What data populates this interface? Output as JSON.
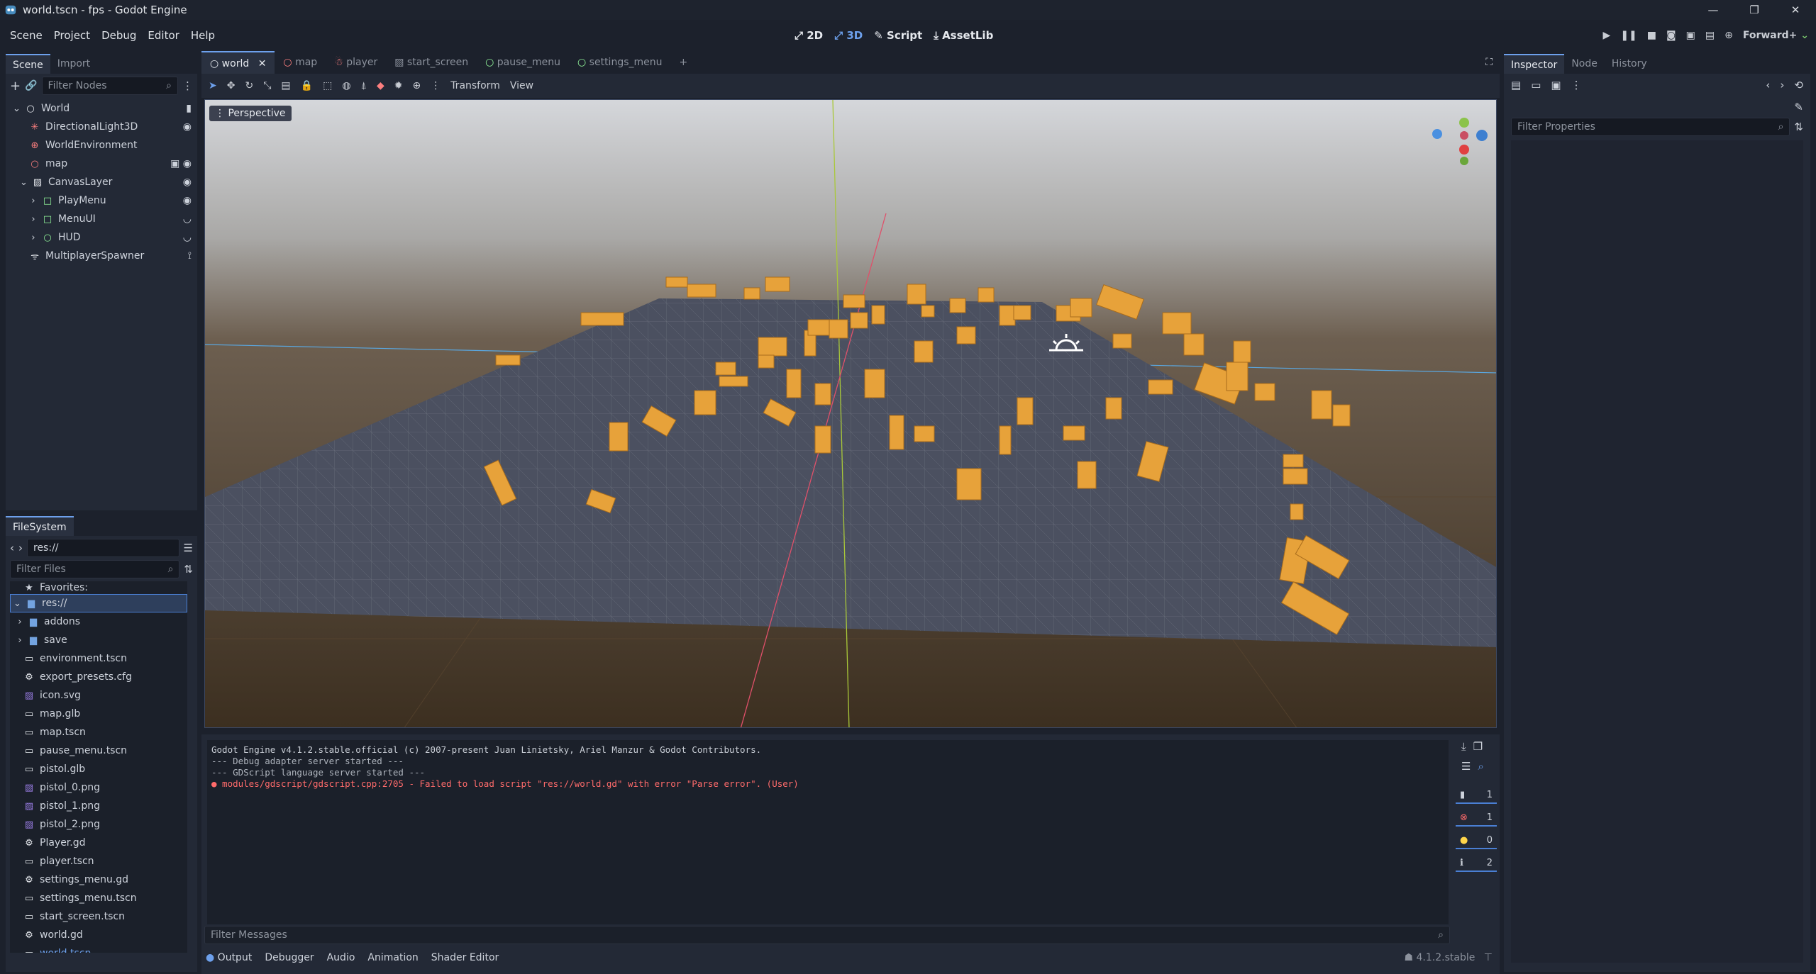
{
  "window": {
    "title": "world.tscn - fps - Godot Engine",
    "controls": [
      "—",
      "❐",
      "✕"
    ]
  },
  "menu": [
    "Scene",
    "Project",
    "Debug",
    "Editor",
    "Help"
  ],
  "modes": {
    "m2d": "2D",
    "m3d": "3D",
    "script": "Script",
    "assetlib": "AssetLib"
  },
  "renderer": "Forward+",
  "scene_panel": {
    "tabs": [
      "Scene",
      "Import"
    ],
    "filter_placeholder": "Filter Nodes",
    "tree": [
      {
        "label": "World",
        "icon": "node3d-icon",
        "depth": 0
      },
      {
        "label": "DirectionalLight3D",
        "icon": "light-icon",
        "depth": 1
      },
      {
        "label": "WorldEnvironment",
        "icon": "globe-icon",
        "depth": 1
      },
      {
        "label": "map",
        "icon": "node3d-icon",
        "depth": 1
      },
      {
        "label": "CanvasLayer",
        "icon": "canvas-icon",
        "depth": 1
      },
      {
        "label": "PlayMenu",
        "icon": "control-icon",
        "depth": 2
      },
      {
        "label": "MenuUI",
        "icon": "control-icon",
        "depth": 2
      },
      {
        "label": "HUD",
        "icon": "control-icon",
        "depth": 2
      },
      {
        "label": "MultiplayerSpawner",
        "icon": "spawner-icon",
        "depth": 1
      }
    ]
  },
  "filesystem": {
    "tab": "FileSystem",
    "path": "res://",
    "filter_placeholder": "Filter Files",
    "favorites": "Favorites:",
    "root": "res://",
    "items": [
      {
        "label": "addons",
        "icon": "folder-icon"
      },
      {
        "label": "save",
        "icon": "folder-icon"
      },
      {
        "label": "environment.tscn",
        "icon": "scene-file-icon"
      },
      {
        "label": "export_presets.cfg",
        "icon": "gear-icon"
      },
      {
        "label": "icon.svg",
        "icon": "image-icon"
      },
      {
        "label": "map.glb",
        "icon": "scene-file-icon"
      },
      {
        "label": "map.tscn",
        "icon": "scene-file-icon"
      },
      {
        "label": "pause_menu.tscn",
        "icon": "scene-file-icon"
      },
      {
        "label": "pistol.glb",
        "icon": "scene-file-icon"
      },
      {
        "label": "pistol_0.png",
        "icon": "image-icon"
      },
      {
        "label": "pistol_1.png",
        "icon": "image-icon"
      },
      {
        "label": "pistol_2.png",
        "icon": "image-icon"
      },
      {
        "label": "Player.gd",
        "icon": "gear-icon"
      },
      {
        "label": "player.tscn",
        "icon": "scene-file-icon"
      },
      {
        "label": "settings_menu.gd",
        "icon": "gear-icon"
      },
      {
        "label": "settings_menu.tscn",
        "icon": "scene-file-icon"
      },
      {
        "label": "start_screen.tscn",
        "icon": "scene-file-icon"
      },
      {
        "label": "world.gd",
        "icon": "gear-icon"
      },
      {
        "label": "world.tscn",
        "icon": "scene-file-icon"
      }
    ]
  },
  "editor_tabs": [
    "world",
    "map",
    "player",
    "start_screen",
    "pause_menu",
    "settings_menu"
  ],
  "viewport": {
    "toolbar_transform": "Transform",
    "toolbar_view": "View",
    "perspective": "Perspective"
  },
  "output": {
    "lines": [
      {
        "text": "Godot Engine v4.1.2.stable.official (c) 2007-present Juan Linietsky, Ariel Manzur & Godot Contributors.",
        "kind": "normal"
      },
      {
        "text": "--- Debug adapter server started ---",
        "kind": "dim"
      },
      {
        "text": "--- GDScript language server started ---",
        "kind": "dim"
      },
      {
        "text": "● modules/gdscript/gdscript.cpp:2705 - Failed to load script \"res://world.gd\" with error \"Parse error\". (User)",
        "kind": "err"
      }
    ],
    "counts": {
      "messages": "1",
      "errors": "1",
      "warnings": "0",
      "info": "2"
    },
    "filter_placeholder": "Filter Messages",
    "tabs": [
      "Output",
      "Debugger",
      "Audio",
      "Animation",
      "Shader Editor"
    ],
    "version": "4.1.2.stable"
  },
  "inspector": {
    "tabs": [
      "Inspector",
      "Node",
      "History"
    ],
    "filter_placeholder": "Filter Properties"
  },
  "colors": {
    "accent": "#6da0ec",
    "error": "#ff6b6b",
    "box": "#e7a23a"
  }
}
